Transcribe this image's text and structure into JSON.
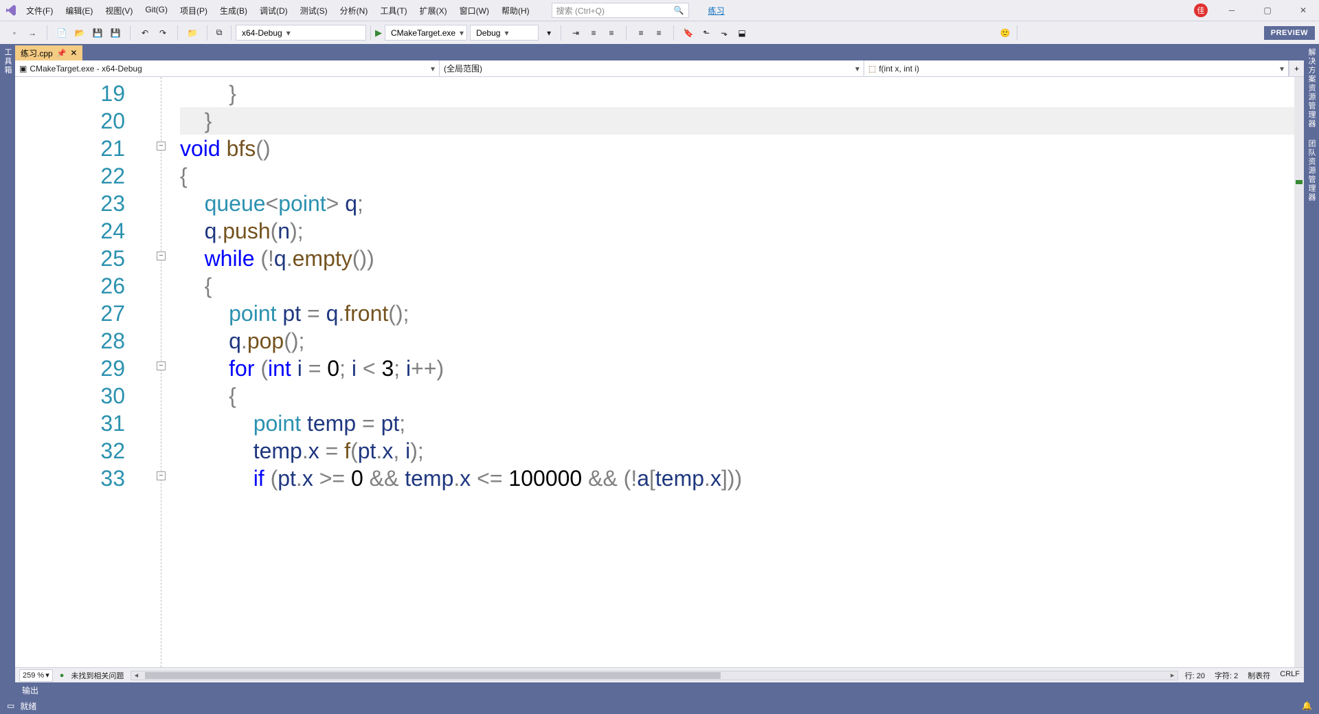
{
  "menu": {
    "items": [
      "文件(F)",
      "编辑(E)",
      "视图(V)",
      "Git(G)",
      "项目(P)",
      "生成(B)",
      "调试(D)",
      "测试(S)",
      "分析(N)",
      "工具(T)",
      "扩展(X)",
      "窗口(W)",
      "帮助(H)"
    ]
  },
  "search": {
    "placeholder": "搜索 (Ctrl+Q)"
  },
  "practice_link": "练习",
  "user_initial": "佳",
  "toolbar": {
    "config": "x64-Debug",
    "target": "CMakeTarget.exe",
    "debug_mode": "Debug",
    "preview": "PREVIEW"
  },
  "side_left": "工具箱",
  "side_right": [
    "解决方案资源管理器",
    "团队资源管理器"
  ],
  "tab": {
    "filename": "练习.cpp"
  },
  "nav": {
    "project": "CMakeTarget.exe - x64-Debug",
    "scope": "(全局范围)",
    "member": "f(int x, int i)"
  },
  "code": {
    "lines": [
      {
        "n": 19,
        "html": "        <span class='par'>}</span>"
      },
      {
        "n": 20,
        "html": "    <span class='par'>}</span>",
        "hl": true
      },
      {
        "n": 21,
        "html": "<span class='kw'>void</span> <span class='fn'>bfs</span><span class='par'>()</span>",
        "fold": true,
        "fold_top": true
      },
      {
        "n": 22,
        "html": "<span class='par'>{</span>"
      },
      {
        "n": 23,
        "html": "    <span class='type'>queue</span><span class='par'>&lt;</span><span class='type'>point</span><span class='par'>&gt;</span> <span class='var'>q</span><span class='par'>;</span>"
      },
      {
        "n": 24,
        "html": "    <span class='var'>q</span><span class='par'>.</span><span class='fn'>push</span><span class='par'>(</span><span class='var'>n</span><span class='par'>);</span>"
      },
      {
        "n": 25,
        "html": "    <span class='kw'>while</span> <span class='par'>(!</span><span class='var'>q</span><span class='par'>.</span><span class='fn'>empty</span><span class='par'>())</span>",
        "fold": true
      },
      {
        "n": 26,
        "html": "    <span class='par'>{</span>"
      },
      {
        "n": 27,
        "html": "        <span class='type'>point</span> <span class='var'>pt</span> <span class='par'>=</span> <span class='var'>q</span><span class='par'>.</span><span class='fn'>front</span><span class='par'>();</span>"
      },
      {
        "n": 28,
        "html": "        <span class='var'>q</span><span class='par'>.</span><span class='fn'>pop</span><span class='par'>();</span>"
      },
      {
        "n": 29,
        "html": "        <span class='kw'>for</span> <span class='par'>(</span><span class='kw'>int</span> <span class='var'>i</span> <span class='par'>=</span> <span class='num'>0</span><span class='par'>;</span> <span class='var'>i</span> <span class='par'>&lt;</span> <span class='num'>3</span><span class='par'>;</span> <span class='var'>i</span><span class='par'>++)</span>",
        "fold": true
      },
      {
        "n": 30,
        "html": "        <span class='par'>{</span>"
      },
      {
        "n": 31,
        "html": "            <span class='type'>point</span> <span class='var'>temp</span> <span class='par'>=</span> <span class='var'>pt</span><span class='par'>;</span>"
      },
      {
        "n": 32,
        "html": "            <span class='var'>temp</span><span class='par'>.</span><span class='var'>x</span> <span class='par'>=</span> <span class='fn'>f</span><span class='par'>(</span><span class='var'>pt</span><span class='par'>.</span><span class='var'>x</span><span class='par'>,</span> <span class='var'>i</span><span class='par'>);</span>"
      },
      {
        "n": 33,
        "html": "            <span class='kw'>if</span> <span class='par'>(</span><span class='var'>pt</span><span class='par'>.</span><span class='var'>x</span> <span class='par'>&gt;=</span> <span class='num'>0</span> <span class='par'>&amp;&amp;</span> <span class='var'>temp</span><span class='par'>.</span><span class='var'>x</span> <span class='par'>&lt;=</span> <span class='num'>100000</span> <span class='par'>&amp;&amp;</span> <span class='par'>(!</span><span class='var'>a</span><span class='par'>[</span><span class='var'>temp</span><span class='par'>.</span><span class='var'>x</span><span class='par'>]))</span>",
        "fold": true
      }
    ]
  },
  "info": {
    "zoom": "259 %",
    "issues": "未找到相关问题",
    "line": "行: 20",
    "char": "字符: 2",
    "tabs": "制表符",
    "eol": "CRLF"
  },
  "output_label": "输出",
  "status": {
    "ready": "就绪"
  }
}
